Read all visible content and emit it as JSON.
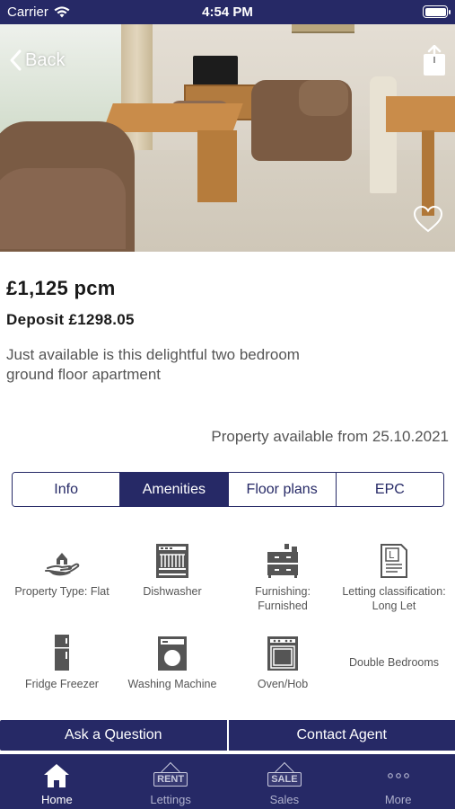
{
  "status_bar": {
    "carrier": "Carrier",
    "time": "4:54 PM"
  },
  "nav": {
    "back_label": "Back"
  },
  "listing": {
    "price": "£1,125 pcm",
    "deposit": "Deposit £1298.05",
    "description": "Just available is this delightful two bedroom ground floor apartment",
    "availability": "Property available from 25.10.2021"
  },
  "tabs": [
    {
      "label": "Info"
    },
    {
      "label": "Amenities"
    },
    {
      "label": "Floor plans"
    },
    {
      "label": "EPC"
    }
  ],
  "active_tab": "Amenities",
  "amenities": [
    {
      "label": "Property Type: Flat",
      "icon": "house-hand-icon"
    },
    {
      "label": "Dishwasher",
      "icon": "dishwasher-icon"
    },
    {
      "label": "Furnishing: Furnished",
      "icon": "furniture-icon"
    },
    {
      "label": "Letting classification: Long Let",
      "icon": "document-icon"
    },
    {
      "label": "Fridge Freezer",
      "icon": "fridge-icon"
    },
    {
      "label": "Washing Machine",
      "icon": "washing-machine-icon"
    },
    {
      "label": "Oven/Hob",
      "icon": "oven-icon"
    },
    {
      "label": "Double Bedrooms",
      "icon": ""
    }
  ],
  "actions": {
    "ask": "Ask a Question",
    "contact": "Contact Agent"
  },
  "tabbar": [
    {
      "label": "Home",
      "icon": "home-icon"
    },
    {
      "label": "Lettings",
      "icon": "rent-sign-icon",
      "tag": "RENT"
    },
    {
      "label": "Sales",
      "icon": "sale-sign-icon",
      "tag": "SALE"
    },
    {
      "label": "More",
      "icon": "more-icon"
    }
  ],
  "colors": {
    "brand": "#262966",
    "text": "#1a1a1a",
    "muted": "#555555"
  }
}
